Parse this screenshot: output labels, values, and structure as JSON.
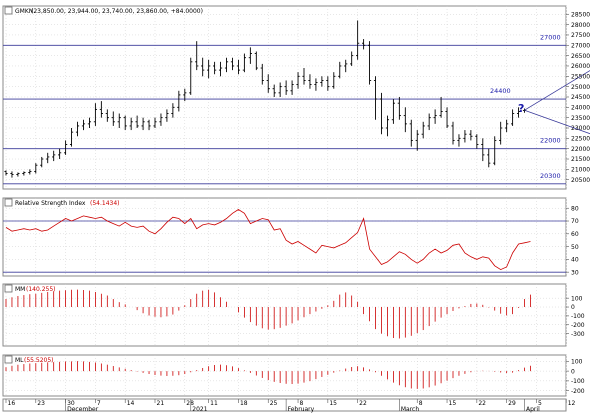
{
  "colors": {
    "price": "#000000",
    "level": "#3a3a9a",
    "indicator": "#cc0000",
    "label_blue": "#1a1aa8",
    "text_red": "#cc0000",
    "grid": "#cfcfcf",
    "frame": "#8a8a8a"
  },
  "panels": {
    "price": {
      "header_prefix": "GMKN",
      "header_values": "(23,850.00, 23,944.00, 23,740.00, 23,860.00, +84.0000)"
    },
    "rsi": {
      "header_prefix": "Relative Strength Index",
      "header_value": "(54.1434)"
    },
    "mm": {
      "header_prefix": "MM",
      "header_value": "(140.255)"
    },
    "ml": {
      "header_prefix": "ML",
      "header_value": "(55.5205)"
    }
  },
  "annotations": {
    "question": "?",
    "levels": [
      {
        "label": "27000",
        "value": 27000
      },
      {
        "label": "24400",
        "value": 24400
      },
      {
        "label": "22000",
        "value": 22000
      },
      {
        "label": "20300",
        "value": 20300
      }
    ]
  },
  "x_axis": {
    "day_ticks": [
      {
        "label": "16",
        "i": 0
      },
      {
        "label": "23",
        "i": 5
      },
      {
        "label": "30",
        "i": 10
      },
      {
        "label": "7",
        "i": 15
      },
      {
        "label": "14",
        "i": 20
      },
      {
        "label": "21",
        "i": 25
      },
      {
        "label": "28",
        "i": 30
      },
      {
        "label": "11",
        "i": 34
      },
      {
        "label": "18",
        "i": 39
      },
      {
        "label": "25",
        "i": 44
      },
      {
        "label": "8",
        "i": 49
      },
      {
        "label": "15",
        "i": 54
      },
      {
        "label": "22",
        "i": 59
      },
      {
        "label": "8",
        "i": 69
      },
      {
        "label": "15",
        "i": 74
      },
      {
        "label": "22",
        "i": 79
      },
      {
        "label": "29",
        "i": 84
      },
      {
        "label": "5",
        "i": 89
      },
      {
        "label": "12",
        "i": 94
      },
      {
        "label": "19",
        "i": 99
      }
    ],
    "month_labels": [
      {
        "label": "December",
        "i": 10
      },
      {
        "label": "2021",
        "i": 31
      },
      {
        "label": "February",
        "i": 47
      },
      {
        "label": "March",
        "i": 66
      },
      {
        "label": "April",
        "i": 87
      }
    ]
  },
  "chart_data": [
    {
      "type": "ohlc",
      "series": [
        {
          "name": "GMKN",
          "ohlc": [
            [
              20900,
              20950,
              20700,
              20800
            ],
            [
              20800,
              20900,
              20600,
              20750
            ],
            [
              20750,
              20850,
              20650,
              20800
            ],
            [
              20800,
              20900,
              20700,
              20850
            ],
            [
              20850,
              21000,
              20750,
              20900
            ],
            [
              20900,
              21300,
              20800,
              21200
            ],
            [
              21200,
              21600,
              21100,
              21500
            ],
            [
              21500,
              21800,
              21300,
              21600
            ],
            [
              21600,
              21900,
              21400,
              21700
            ],
            [
              21700,
              22000,
              21500,
              21800
            ],
            [
              21800,
              22400,
              21700,
              22200
            ],
            [
              22200,
              23000,
              22100,
              22800
            ],
            [
              22800,
              23300,
              22600,
              23100
            ],
            [
              23100,
              23400,
              22900,
              23200
            ],
            [
              23200,
              23500,
              23000,
              23300
            ],
            [
              23300,
              24200,
              23100,
              23900
            ],
            [
              23900,
              24300,
              23500,
              23700
            ],
            [
              23700,
              23900,
              23300,
              23500
            ],
            [
              23500,
              23800,
              23100,
              23300
            ],
            [
              23300,
              23700,
              23000,
              23500
            ],
            [
              23500,
              23600,
              22900,
              23100
            ],
            [
              23100,
              23500,
              22900,
              23300
            ],
            [
              23300,
              23600,
              23000,
              23100
            ],
            [
              23100,
              23500,
              22900,
              23300
            ],
            [
              23300,
              23400,
              22900,
              23100
            ],
            [
              23100,
              23500,
              23000,
              23300
            ],
            [
              23300,
              23700,
              23100,
              23500
            ],
            [
              23500,
              23900,
              23300,
              23700
            ],
            [
              23700,
              24200,
              23500,
              24000
            ],
            [
              24000,
              24800,
              23800,
              24600
            ],
            [
              24600,
              24900,
              24300,
              24700
            ],
            [
              24700,
              26400,
              24600,
              26200
            ],
            [
              26200,
              27200,
              25800,
              26000
            ],
            [
              26000,
              26400,
              25500,
              25800
            ],
            [
              25800,
              26300,
              25400,
              26000
            ],
            [
              26000,
              26200,
              25600,
              25800
            ],
            [
              25800,
              26200,
              25500,
              25900
            ],
            [
              25900,
              26400,
              25700,
              26200
            ],
            [
              26200,
              26400,
              25800,
              26000
            ],
            [
              26000,
              26300,
              25600,
              25800
            ],
            [
              25800,
              26600,
              25700,
              26400
            ],
            [
              26400,
              26900,
              26100,
              26600
            ],
            [
              26600,
              26700,
              25800,
              25900
            ],
            [
              25900,
              26100,
              25100,
              25300
            ],
            [
              25300,
              25600,
              24700,
              24900
            ],
            [
              24900,
              25100,
              24500,
              24700
            ],
            [
              24700,
              25200,
              24500,
              25000
            ],
            [
              25000,
              25300,
              24600,
              24800
            ],
            [
              24800,
              25300,
              24600,
              25100
            ],
            [
              25100,
              25700,
              24900,
              25500
            ],
            [
              25500,
              25900,
              25100,
              25300
            ],
            [
              25300,
              25600,
              24900,
              25100
            ],
            [
              25100,
              25400,
              24800,
              25200
            ],
            [
              25200,
              25500,
              25000,
              25300
            ],
            [
              25300,
              25500,
              24800,
              25000
            ],
            [
              25000,
              25700,
              24900,
              25500
            ],
            [
              25500,
              26200,
              25400,
              26000
            ],
            [
              26000,
              26300,
              25700,
              26100
            ],
            [
              26100,
              26700,
              26000,
              26500
            ],
            [
              26500,
              28200,
              26300,
              27100
            ],
            [
              27100,
              27300,
              26800,
              27000
            ],
            [
              27000,
              27200,
              25100,
              25300
            ],
            [
              25300,
              25500,
              23400,
              24400
            ],
            [
              24400,
              24700,
              22700,
              23000
            ],
            [
              23000,
              23600,
              22600,
              23400
            ],
            [
              23400,
              24400,
              23200,
              24200
            ],
            [
              24200,
              24500,
              23400,
              23600
            ],
            [
              23600,
              24000,
              22800,
              23200
            ],
            [
              23200,
              23400,
              22100,
              22400
            ],
            [
              22400,
              22900,
              21900,
              22700
            ],
            [
              22700,
              23300,
              22500,
              23100
            ],
            [
              23100,
              23700,
              22900,
              23500
            ],
            [
              23500,
              23900,
              23200,
              23600
            ],
            [
              23600,
              24500,
              23500,
              23800
            ],
            [
              23800,
              24000,
              23000,
              23100
            ],
            [
              23100,
              23300,
              22200,
              22400
            ],
            [
              22400,
              22700,
              22100,
              22500
            ],
            [
              22500,
              22900,
              22300,
              22700
            ],
            [
              22700,
              22900,
              22400,
              22600
            ],
            [
              22600,
              22700,
              22000,
              22200
            ],
            [
              22200,
              22500,
              21400,
              21700
            ],
            [
              21700,
              22000,
              21100,
              21300
            ],
            [
              21300,
              22600,
              21200,
              22400
            ],
            [
              22400,
              23300,
              22200,
              23000
            ],
            [
              23000,
              23400,
              22800,
              23200
            ],
            [
              23200,
              23900,
              23100,
              23700
            ],
            [
              23700,
              24000,
              23500,
              23800
            ],
            [
              23850,
              23944,
              23740,
              23860
            ]
          ]
        }
      ],
      "levels": [
        27000,
        24400,
        22000,
        20300
      ],
      "ylim": [
        20050,
        28900
      ],
      "y_ticks": [
        20500,
        21000,
        21500,
        22000,
        22500,
        23000,
        23500,
        24000,
        24500,
        25000,
        25500,
        26000,
        26500,
        27000,
        27500,
        28000,
        28500
      ],
      "projection": {
        "from": {
          "i": 87,
          "value": 23860
        },
        "to_up": {
          "i": 105,
          "value": 27000
        },
        "to_down": {
          "i": 105,
          "value": 22000
        }
      }
    },
    {
      "type": "line",
      "series": [
        {
          "name": "Relative Strength Index",
          "values": [
            65,
            62,
            63,
            64,
            63,
            64,
            62,
            63,
            66,
            69,
            72,
            70,
            72,
            74,
            73,
            72,
            73,
            70,
            68,
            66,
            69,
            66,
            65,
            66,
            62,
            60,
            64,
            69,
            73,
            72,
            68,
            72,
            64,
            67,
            68,
            67,
            69,
            72,
            76,
            79,
            76,
            68,
            70,
            72,
            71,
            63,
            64,
            55,
            52,
            54,
            51,
            48,
            45,
            51,
            50,
            49,
            51,
            53,
            57,
            61,
            72,
            48,
            42,
            36,
            38,
            42,
            46,
            44,
            40,
            37,
            40,
            45,
            48,
            45,
            47,
            51,
            52,
            45,
            42,
            40,
            42,
            41,
            35,
            32,
            34,
            45,
            52,
            53,
            54
          ]
        }
      ],
      "ylim": [
        27,
        88
      ],
      "y_ticks": [
        30,
        40,
        50,
        60,
        70,
        80
      ],
      "levels": [
        70,
        30
      ]
    },
    {
      "type": "bar",
      "series": [
        {
          "name": "MM",
          "values": [
            90,
            110,
            125,
            135,
            145,
            150,
            160,
            170,
            178,
            185,
            190,
            195,
            196,
            192,
            185,
            170,
            150,
            130,
            90,
            55,
            30,
            0,
            -35,
            -70,
            -95,
            -110,
            -115,
            -105,
            -85,
            -40,
            20,
            90,
            150,
            185,
            195,
            165,
            110,
            60,
            0,
            -60,
            -120,
            -170,
            -210,
            -240,
            -255,
            -250,
            -235,
            -210,
            -185,
            -150,
            -115,
            -80,
            -50,
            -20,
            20,
            70,
            140,
            165,
            130,
            60,
            -80,
            -160,
            -250,
            -300,
            -330,
            -350,
            -355,
            -345,
            -325,
            -295,
            -260,
            -215,
            -165,
            -120,
            -80,
            -45,
            -15,
            10,
            35,
            40,
            25,
            -5,
            -40,
            -75,
            -95,
            -80,
            -10,
            90,
            140
          ]
        }
      ],
      "ylim": [
        -440,
        260
      ],
      "y_ticks": [
        -300,
        -200,
        -100,
        0,
        100
      ]
    },
    {
      "type": "bar",
      "series": [
        {
          "name": "ML",
          "values": [
            40,
            55,
            65,
            72,
            78,
            82,
            86,
            90,
            92,
            95,
            98,
            100,
            102,
            100,
            95,
            88,
            78,
            66,
            52,
            38,
            24,
            10,
            -5,
            -18,
            -30,
            -40,
            -46,
            -50,
            -48,
            -42,
            -30,
            -12,
            10,
            32,
            50,
            62,
            66,
            60,
            48,
            30,
            8,
            -18,
            -45,
            -70,
            -92,
            -110,
            -122,
            -130,
            -132,
            -128,
            -118,
            -102,
            -82,
            -60,
            -38,
            -16,
            6,
            26,
            42,
            50,
            38,
            18,
            -12,
            -48,
            -85,
            -118,
            -145,
            -165,
            -178,
            -182,
            -178,
            -166,
            -148,
            -124,
            -98,
            -72,
            -48,
            -28,
            -12,
            -2,
            4,
            2,
            -6,
            -14,
            -20,
            -16,
            10,
            36,
            55
          ]
        }
      ],
      "ylim": [
        -255,
        165
      ],
      "y_ticks": [
        -200,
        -100,
        0,
        100
      ]
    }
  ]
}
